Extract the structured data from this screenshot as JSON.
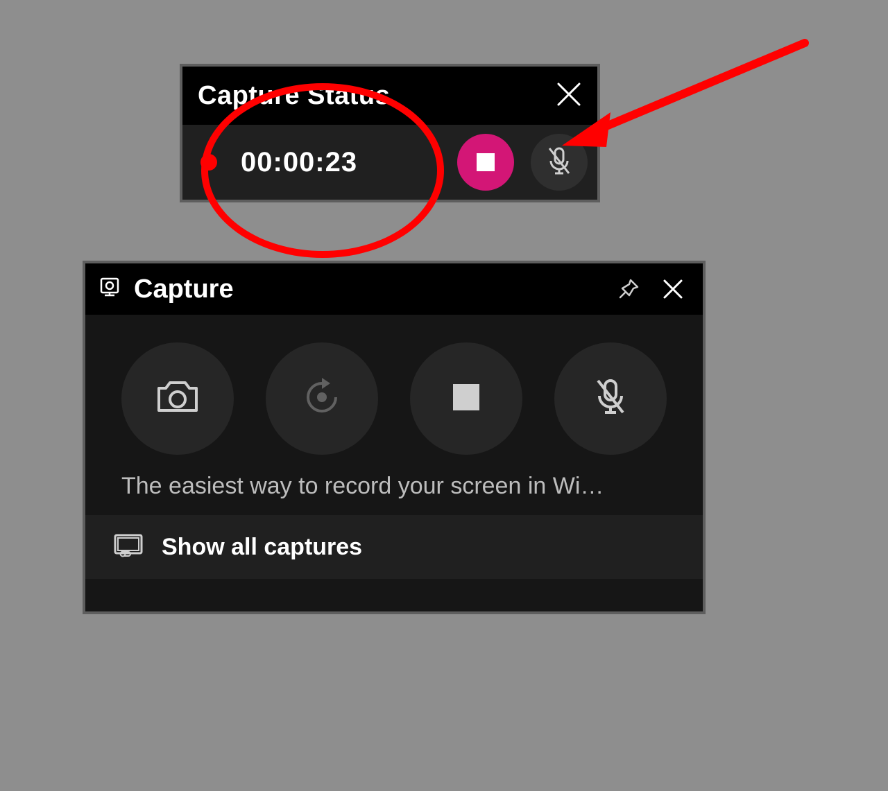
{
  "status_widget": {
    "title": "Capture Status",
    "elapsed_time": "00:00:23"
  },
  "capture_panel": {
    "title": "Capture",
    "context_text": "The easiest way to record your screen in Wi…",
    "footer_link": "Show all captures"
  },
  "colors": {
    "accent_stop": "#d31676",
    "annotation": "#ff0000"
  }
}
